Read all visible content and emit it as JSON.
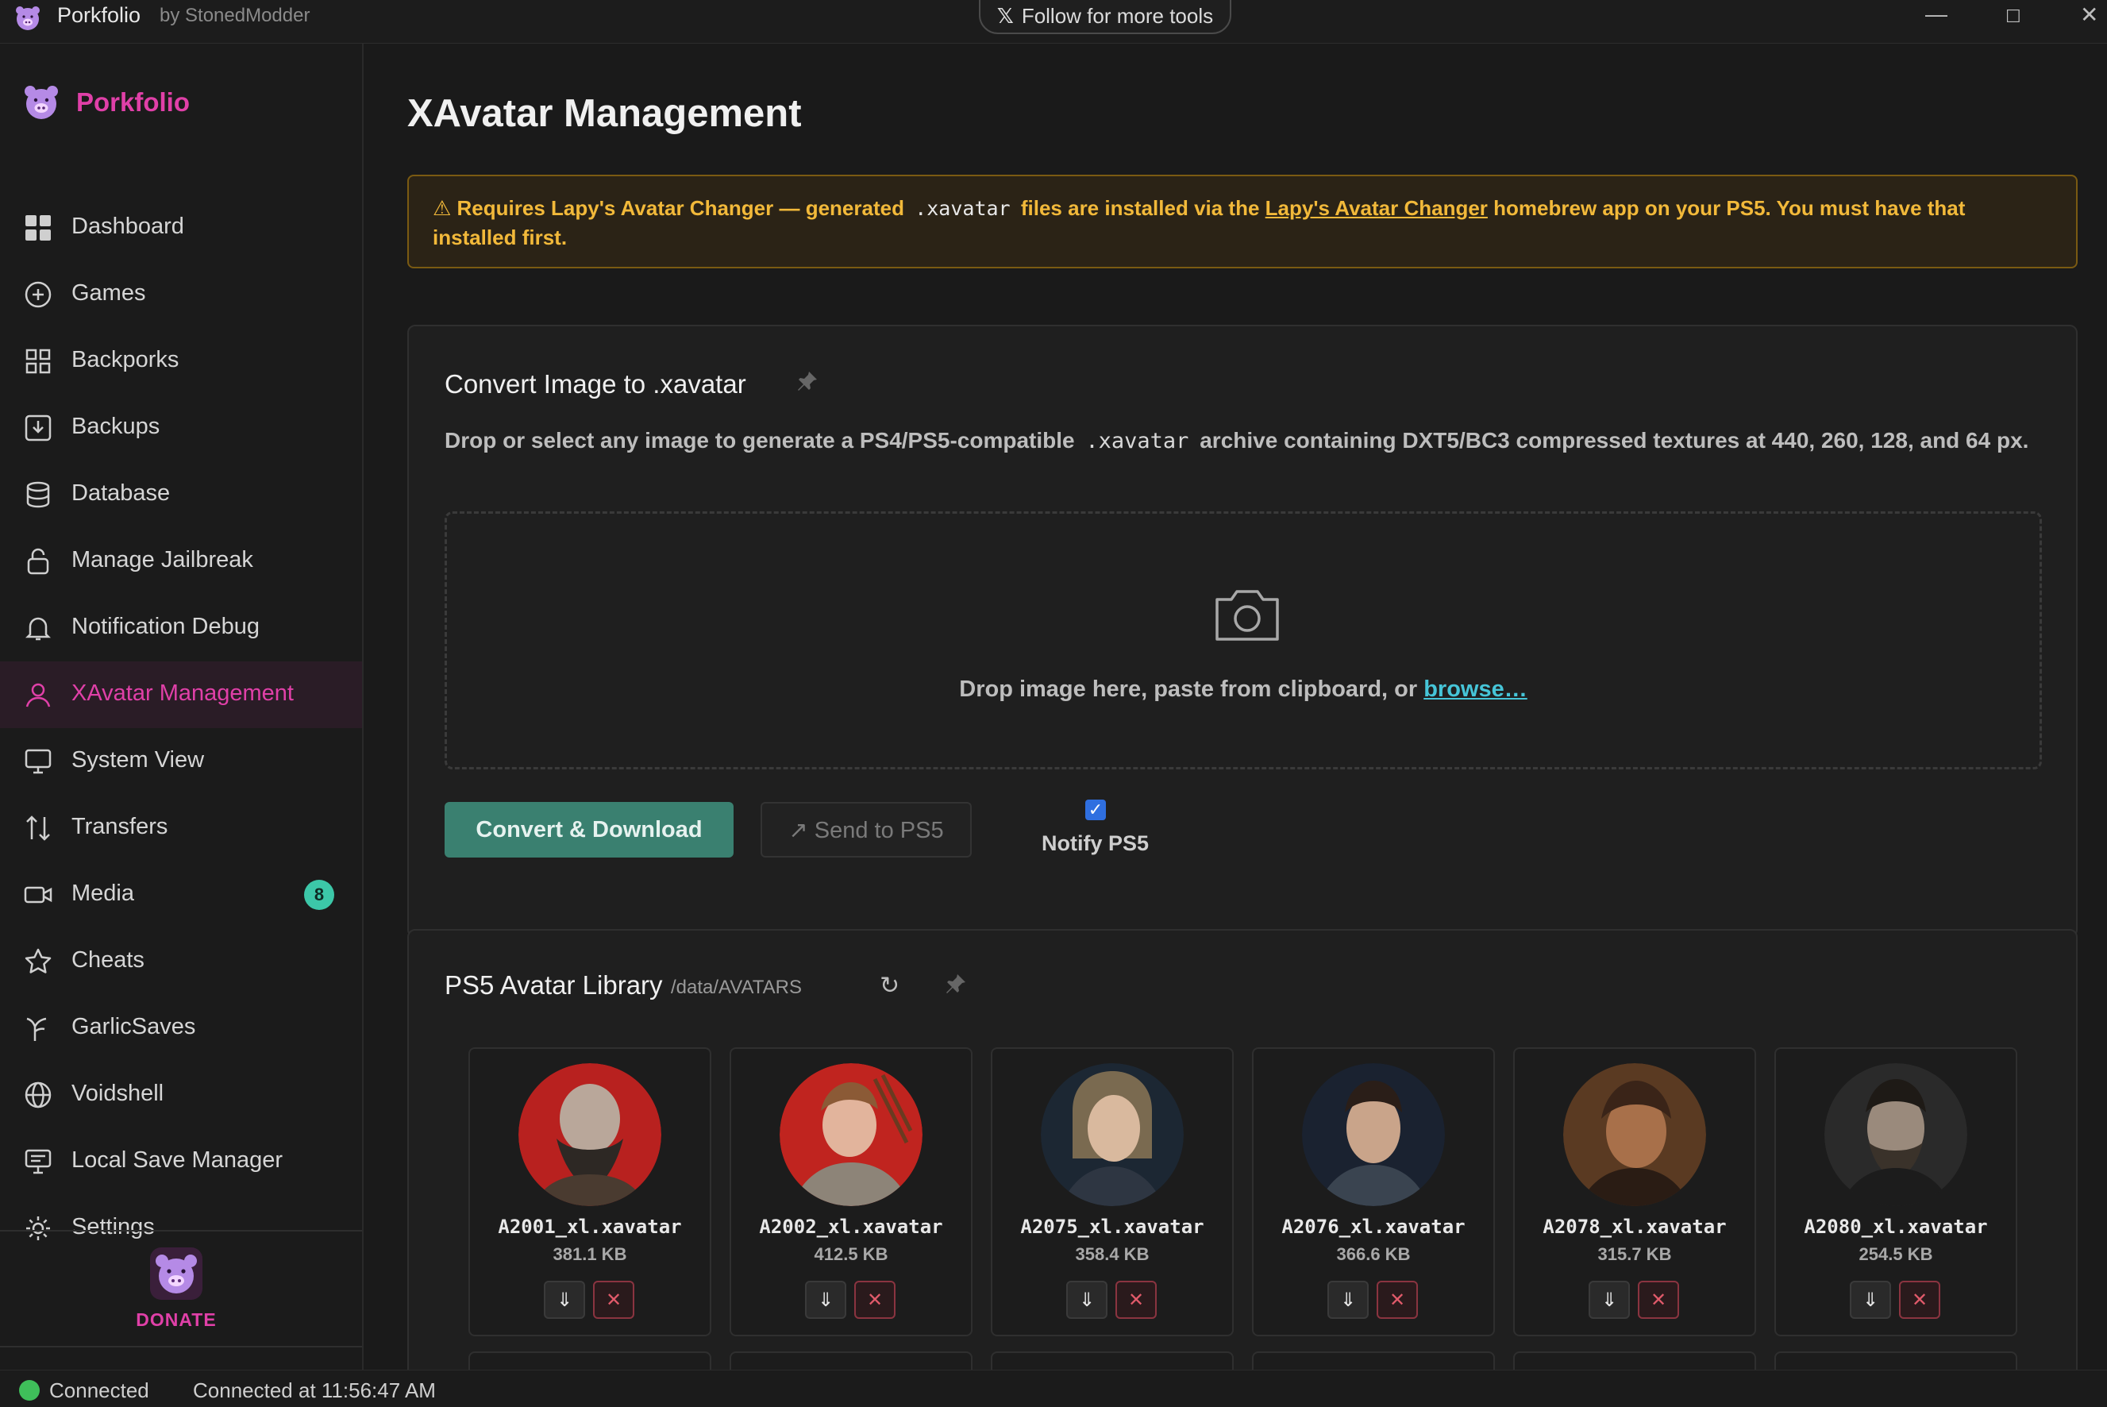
{
  "titlebar": {
    "app_name": "Porkfolio",
    "app_by": "by StonedModder",
    "follow_label": "Follow for more tools",
    "minimize": "—",
    "maximize": "☐",
    "close": "✕"
  },
  "sidebar": {
    "brand": "Porkfolio",
    "items": [
      {
        "label": "Dashboard",
        "icon": "dashboard-icon"
      },
      {
        "label": "Games",
        "icon": "plus-circle-icon"
      },
      {
        "label": "Backporks",
        "icon": "grid-icon"
      },
      {
        "label": "Backups",
        "icon": "download-box-icon"
      },
      {
        "label": "Database",
        "icon": "database-icon"
      },
      {
        "label": "Manage Jailbreak",
        "icon": "lock-icon"
      },
      {
        "label": "Notification Debug",
        "icon": "bell-icon"
      },
      {
        "label": "XAvatar Management",
        "icon": "user-icon",
        "active": true
      },
      {
        "label": "System View",
        "icon": "monitor-icon"
      },
      {
        "label": "Transfers",
        "icon": "transfer-icon"
      },
      {
        "label": "Media",
        "icon": "video-icon",
        "badge": "8"
      },
      {
        "label": "Cheats",
        "icon": "star-icon"
      },
      {
        "label": "GarlicSaves",
        "icon": "garlic-icon"
      },
      {
        "label": "Voidshell",
        "icon": "globe-icon"
      },
      {
        "label": "Local Save Manager",
        "icon": "local-save-icon"
      },
      {
        "label": "Settings",
        "icon": "sun-gear-icon"
      }
    ],
    "donate_label": "DONATE",
    "accent": "#e040a8"
  },
  "main": {
    "title": "XAvatar Management",
    "warning": {
      "prefix": "⚠ Requires Lapy's Avatar Changer — generated",
      "code": ".xavatar",
      "middle": "files are installed via the",
      "link": "Lapy's Avatar Changer",
      "suffix": "homebrew app on your PS5. You must have that installed first."
    },
    "convert": {
      "title": "Convert Image to .xavatar",
      "desc_prefix": "Drop or select any image to generate a PS4/PS5-compatible",
      "desc_code": ".xavatar",
      "desc_suffix": "archive containing DXT5/BC3 compressed textures at 440, 260, 128, and 64 px.",
      "drop_text": "Drop image here, paste from clipboard, or",
      "browse": "browse…",
      "convert_button": "Convert & Download",
      "send_button": "↗ Send to PS5",
      "notify_label": "Notify PS5",
      "notify_checked": true
    },
    "library": {
      "title": "PS5 Avatar Library",
      "path": "/data/AVATARS",
      "avatars": [
        {
          "name": "A2001_xl.xavatar",
          "size": "381.1 KB"
        },
        {
          "name": "A2002_xl.xavatar",
          "size": "412.5 KB"
        },
        {
          "name": "A2075_xl.xavatar",
          "size": "358.4 KB"
        },
        {
          "name": "A2076_xl.xavatar",
          "size": "366.6 KB"
        },
        {
          "name": "A2078_xl.xavatar",
          "size": "315.7 KB"
        },
        {
          "name": "A2080_xl.xavatar",
          "size": "254.5 KB"
        }
      ]
    }
  },
  "status": {
    "state": "Connected",
    "detail": "Connected at 11:56:47 AM",
    "color": "#3fbf5a"
  }
}
